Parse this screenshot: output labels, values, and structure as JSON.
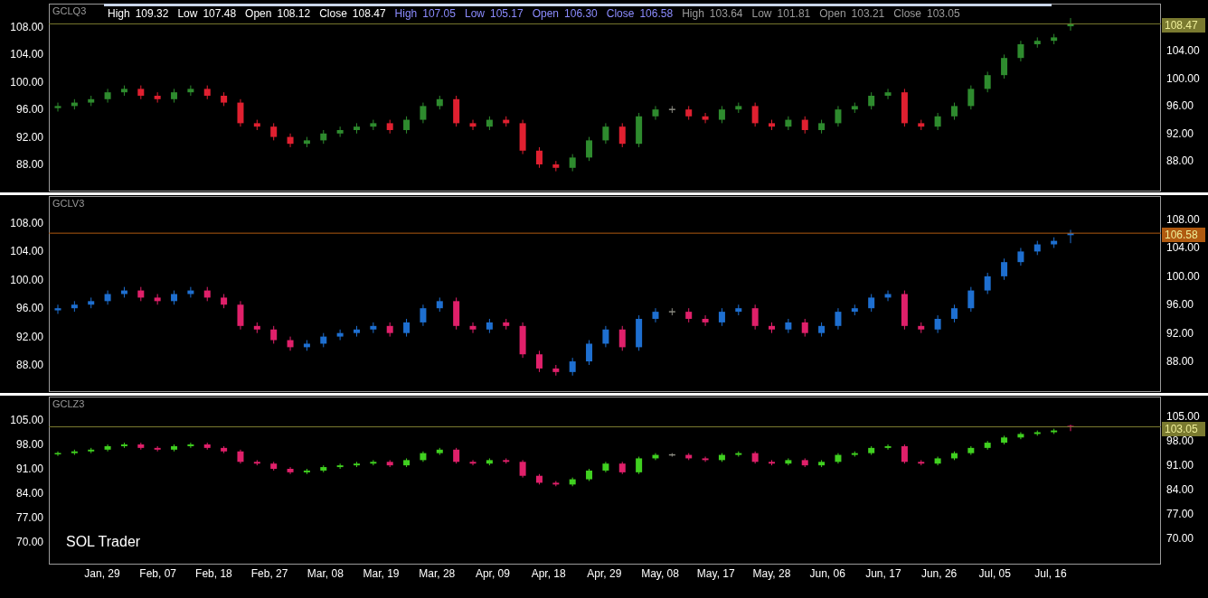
{
  "legend": [
    {
      "color": "#ffffff",
      "items": [
        {
          "label": "High",
          "value": "109.32"
        },
        {
          "label": "Low",
          "value": "107.48"
        },
        {
          "label": "Open",
          "value": "108.12"
        },
        {
          "label": "Close",
          "value": "108.47"
        }
      ]
    },
    {
      "color": "#8c8cff",
      "items": [
        {
          "label": "High",
          "value": "107.05"
        },
        {
          "label": "Low",
          "value": "105.17"
        },
        {
          "label": "Open",
          "value": "106.30"
        },
        {
          "label": "Close",
          "value": "106.58"
        }
      ]
    },
    {
      "color": "#9a9a9a",
      "items": [
        {
          "label": "High",
          "value": "103.64"
        },
        {
          "label": "Low",
          "value": "101.81"
        },
        {
          "label": "Open",
          "value": "103.21"
        },
        {
          "label": "Close",
          "value": "103.05"
        }
      ]
    }
  ],
  "panels": [
    {
      "symbol": "GCLQ3",
      "right_labels": [
        "104.00",
        "100.00",
        "96.00",
        "92.00",
        "88.00"
      ],
      "chart_data": {
        "type": "candlestick",
        "ylim": [
          84.05,
          111.42
        ],
        "yticks": [
          {
            "value": 108,
            "label": "108.00"
          },
          {
            "value": 104,
            "label": "104.00"
          },
          {
            "value": 100,
            "label": "100.00"
          },
          {
            "value": 96,
            "label": "96.00"
          },
          {
            "value": 92,
            "label": "92.00"
          },
          {
            "value": 88,
            "label": "88.00"
          }
        ],
        "ref_lines": [
          {
            "axis": "y",
            "value": 108.47,
            "label": "108.47",
            "color": "#7a7a30"
          }
        ],
        "ohlc": [
          [
            96.2,
            97,
            95.7,
            96.5
          ],
          [
            96.5,
            97.5,
            96,
            97
          ],
          [
            97,
            98,
            96.5,
            97.5
          ],
          [
            97.5,
            99,
            97,
            98.5
          ],
          [
            98.5,
            99.5,
            98,
            99
          ],
          [
            99,
            99.5,
            97.5,
            98
          ],
          [
            98,
            98.5,
            97,
            97.5
          ],
          [
            97.5,
            99,
            97,
            98.5
          ],
          [
            98.5,
            99.5,
            98,
            99
          ],
          [
            99,
            99.5,
            97.5,
            98
          ],
          [
            98,
            98.5,
            96.5,
            97
          ],
          [
            97,
            97.5,
            93.5,
            94
          ],
          [
            94,
            94.5,
            93,
            93.5
          ],
          [
            93.5,
            94,
            91.5,
            92
          ],
          [
            92,
            92.5,
            90.5,
            91
          ],
          [
            91,
            92,
            90.5,
            91.5
          ],
          [
            91.5,
            93,
            91,
            92.5
          ],
          [
            92.5,
            93.5,
            92,
            93
          ],
          [
            93,
            94,
            92.5,
            93.5
          ],
          [
            93.5,
            94.5,
            93,
            94
          ],
          [
            94,
            94.5,
            92.5,
            93
          ],
          [
            93,
            95,
            92.5,
            94.5
          ],
          [
            94.5,
            97,
            94,
            96.5
          ],
          [
            96.5,
            98,
            96,
            97.5
          ],
          [
            97.5,
            98,
            93.5,
            94
          ],
          [
            94,
            94.5,
            93,
            93.5
          ],
          [
            93.5,
            95,
            93,
            94.5
          ],
          [
            94.5,
            95,
            93.5,
            94
          ],
          [
            94,
            94.5,
            89.5,
            90
          ],
          [
            90,
            90.5,
            87.5,
            88
          ],
          [
            88,
            88.5,
            87,
            87.5
          ],
          [
            87.5,
            89.5,
            87,
            89
          ],
          [
            89,
            92,
            88.5,
            91.5
          ],
          [
            91.5,
            94,
            91,
            93.5
          ],
          [
            93.5,
            94,
            90.5,
            91
          ],
          [
            91,
            95.5,
            90.5,
            95
          ],
          [
            95,
            96.5,
            94.5,
            96
          ],
          [
            96,
            96.5,
            95.5,
            96
          ],
          [
            96,
            96.5,
            94.5,
            95
          ],
          [
            95,
            95.5,
            94,
            94.5
          ],
          [
            94.5,
            96.5,
            94,
            96
          ],
          [
            96,
            97,
            95.5,
            96.5
          ],
          [
            96.5,
            97,
            93.5,
            94
          ],
          [
            94,
            94.5,
            93,
            93.5
          ],
          [
            93.5,
            95,
            93,
            94.5
          ],
          [
            94.5,
            95,
            92.5,
            93
          ],
          [
            93,
            94.5,
            92.5,
            94
          ],
          [
            94,
            96.5,
            93.5,
            96
          ],
          [
            96,
            97,
            95.5,
            96.5
          ],
          [
            96.5,
            98.5,
            96,
            98
          ],
          [
            98,
            99,
            97.5,
            98.5
          ],
          [
            98.5,
            99,
            93.5,
            94
          ],
          [
            94,
            94.5,
            93,
            93.5
          ],
          [
            93.5,
            95.5,
            93,
            95
          ],
          [
            95,
            97,
            94.5,
            96.5
          ],
          [
            96.5,
            99.5,
            96,
            99
          ],
          [
            99,
            101.5,
            98.5,
            101
          ],
          [
            101,
            104,
            100.5,
            103.5
          ],
          [
            103.5,
            106,
            103,
            105.5
          ],
          [
            105.5,
            106.5,
            105,
            106
          ],
          [
            106,
            107,
            105.5,
            106.5
          ],
          [
            108.12,
            109.32,
            107.48,
            108.47
          ]
        ]
      }
    },
    {
      "symbol": "GCLV3",
      "right_labels": [
        "108.00",
        "104.00",
        "100.00",
        "96.00",
        "92.00",
        "88.00"
      ],
      "chart_data": {
        "type": "candlestick",
        "ylim": [
          84.18,
          111.82
        ],
        "yticks": [
          {
            "value": 108,
            "label": "108.00"
          },
          {
            "value": 104,
            "label": "104.00"
          },
          {
            "value": 100,
            "label": "100.00"
          },
          {
            "value": 96,
            "label": "96.00"
          },
          {
            "value": 92,
            "label": "92.00"
          },
          {
            "value": 88,
            "label": "88.00"
          }
        ],
        "ref_lines": [
          {
            "axis": "y",
            "value": 106.58,
            "label": "106.58",
            "color": "#b05a10"
          }
        ],
        "ohlc": [
          [
            95.7,
            96.5,
            95.2,
            96
          ],
          [
            96,
            97,
            95.5,
            96.5
          ],
          [
            96.5,
            97.5,
            96,
            97
          ],
          [
            97,
            98.5,
            96.5,
            98
          ],
          [
            98,
            99,
            97.5,
            98.5
          ],
          [
            98.5,
            99,
            97,
            97.5
          ],
          [
            97.5,
            98,
            96.5,
            97
          ],
          [
            97,
            98.5,
            96.5,
            98
          ],
          [
            98,
            99,
            97.5,
            98.5
          ],
          [
            98.5,
            99,
            97,
            97.5
          ],
          [
            97.5,
            98,
            96,
            96.5
          ],
          [
            96.5,
            97,
            93,
            93.5
          ],
          [
            93.5,
            94,
            92.5,
            93
          ],
          [
            93,
            93.5,
            91,
            91.5
          ],
          [
            91.5,
            92,
            90,
            90.5
          ],
          [
            90.5,
            91.5,
            90,
            91
          ],
          [
            91,
            92.5,
            90.5,
            92
          ],
          [
            92,
            93,
            91.5,
            92.5
          ],
          [
            92.5,
            93.5,
            92,
            93
          ],
          [
            93,
            94,
            92.5,
            93.5
          ],
          [
            93.5,
            94,
            92,
            92.5
          ],
          [
            92.5,
            94.5,
            92,
            94
          ],
          [
            94,
            96.5,
            93.5,
            96
          ],
          [
            96,
            97.5,
            95.5,
            97
          ],
          [
            97,
            97.5,
            93,
            93.5
          ],
          [
            93.5,
            94,
            92.5,
            93
          ],
          [
            93,
            94.5,
            92.5,
            94
          ],
          [
            94,
            94.5,
            93,
            93.5
          ],
          [
            93.5,
            94,
            89,
            89.5
          ],
          [
            89.5,
            90,
            87,
            87.5
          ],
          [
            87.5,
            88,
            86.5,
            87
          ],
          [
            87,
            89,
            86.5,
            88.5
          ],
          [
            88.5,
            91.5,
            88,
            91
          ],
          [
            91,
            93.5,
            90.5,
            93
          ],
          [
            93,
            93.5,
            90,
            90.5
          ],
          [
            90.5,
            95,
            90,
            94.5
          ],
          [
            94.5,
            96,
            94,
            95.5
          ],
          [
            95.5,
            96,
            95,
            95.5
          ],
          [
            95.5,
            96,
            94,
            94.5
          ],
          [
            94.5,
            95,
            93.5,
            94
          ],
          [
            94,
            96,
            93.5,
            95.5
          ],
          [
            95.5,
            96.5,
            95,
            96
          ],
          [
            96,
            96.5,
            93,
            93.5
          ],
          [
            93.5,
            94,
            92.5,
            93
          ],
          [
            93,
            94.5,
            92.5,
            94
          ],
          [
            94,
            94.5,
            92,
            92.5
          ],
          [
            92.5,
            94,
            92,
            93.5
          ],
          [
            93.5,
            96,
            93,
            95.5
          ],
          [
            95.5,
            96.5,
            95,
            96
          ],
          [
            96,
            98,
            95.5,
            97.5
          ],
          [
            97.5,
            98.5,
            97,
            98
          ],
          [
            98,
            98.5,
            93,
            93.5
          ],
          [
            93.5,
            94,
            92.5,
            93
          ],
          [
            93,
            95,
            92.5,
            94.5
          ],
          [
            94.5,
            96.5,
            94,
            96
          ],
          [
            96,
            99,
            95.5,
            98.5
          ],
          [
            98.5,
            101,
            98,
            100.5
          ],
          [
            100.5,
            103,
            100,
            102.5
          ],
          [
            102.5,
            104.5,
            102,
            104
          ],
          [
            104,
            105.5,
            103.5,
            105
          ],
          [
            105,
            106,
            104.5,
            105.5
          ],
          [
            106.3,
            107.05,
            105.17,
            106.58
          ]
        ]
      }
    },
    {
      "symbol": "GCLZ3",
      "right_labels": [
        "105.00",
        "98.00",
        "91.00",
        "84.00",
        "77.00",
        "70.00"
      ],
      "chart_data": {
        "type": "candlestick",
        "ylim": [
          63.52,
          111.74
        ],
        "yticks": [
          {
            "value": 105,
            "label": "105.00"
          },
          {
            "value": 98,
            "label": "98.00"
          },
          {
            "value": 91,
            "label": "91.00"
          },
          {
            "value": 84,
            "label": "84.00"
          },
          {
            "value": 77,
            "label": "77.00"
          },
          {
            "value": 70,
            "label": "70.00"
          }
        ],
        "ref_lines": [
          {
            "axis": "y",
            "value": 103.05,
            "label": "103.05",
            "color": "#7a7a30"
          }
        ],
        "ohlc": [
          [
            95.2,
            96,
            94.7,
            95.5
          ],
          [
            95.5,
            96.5,
            95,
            96
          ],
          [
            96,
            97,
            95.5,
            96.5
          ],
          [
            96.5,
            98,
            96,
            97.5
          ],
          [
            97.5,
            98.5,
            97,
            98
          ],
          [
            98,
            98.5,
            96.5,
            97
          ],
          [
            97,
            97.5,
            96,
            96.5
          ],
          [
            96.5,
            98,
            96,
            97.5
          ],
          [
            97.5,
            98.5,
            97,
            98
          ],
          [
            98,
            98.5,
            96.5,
            97
          ],
          [
            97,
            97.5,
            95.5,
            96
          ],
          [
            96,
            96.5,
            92.5,
            93
          ],
          [
            93,
            93.5,
            92,
            92.5
          ],
          [
            92.5,
            93,
            90.5,
            91
          ],
          [
            91,
            91.5,
            89.5,
            90
          ],
          [
            90,
            91,
            89.5,
            90.5
          ],
          [
            90.5,
            92,
            90,
            91.5
          ],
          [
            91.5,
            92.5,
            91,
            92
          ],
          [
            92,
            93,
            91.5,
            92.5
          ],
          [
            92.5,
            93.5,
            92,
            93
          ],
          [
            93,
            93.5,
            91.5,
            92
          ],
          [
            92,
            94,
            91.5,
            93.5
          ],
          [
            93.5,
            96,
            93,
            95.5
          ],
          [
            95.5,
            97,
            95,
            96.5
          ],
          [
            96.5,
            97,
            92.5,
            93
          ],
          [
            93,
            93.5,
            92,
            92.5
          ],
          [
            92.5,
            94,
            92,
            93.5
          ],
          [
            93.5,
            94,
            92.5,
            93
          ],
          [
            93,
            93.5,
            88.5,
            89
          ],
          [
            89,
            89.5,
            86.5,
            87
          ],
          [
            87,
            87.5,
            86,
            86.5
          ],
          [
            86.5,
            88.5,
            86,
            88
          ],
          [
            88,
            91,
            87.5,
            90.5
          ],
          [
            90.5,
            93,
            90,
            92.5
          ],
          [
            92.5,
            93,
            89.5,
            90
          ],
          [
            90,
            94.5,
            89.5,
            94
          ],
          [
            94,
            95.5,
            93.5,
            95
          ],
          [
            95,
            95.5,
            94.5,
            95
          ],
          [
            95,
            95.5,
            93.5,
            94
          ],
          [
            94,
            94.5,
            93,
            93.5
          ],
          [
            93.5,
            95.5,
            93,
            95
          ],
          [
            95,
            96,
            94.5,
            95.5
          ],
          [
            95.5,
            96,
            92.5,
            93
          ],
          [
            93,
            93.5,
            92,
            92.5
          ],
          [
            92.5,
            94,
            92,
            93.5
          ],
          [
            93.5,
            94,
            91.5,
            92
          ],
          [
            92,
            93.5,
            91.5,
            93
          ],
          [
            93,
            95.5,
            92.5,
            95
          ],
          [
            95,
            96,
            94.5,
            95.5
          ],
          [
            95.5,
            97.5,
            95,
            97
          ],
          [
            97,
            98,
            96.5,
            97.5
          ],
          [
            97.5,
            98,
            92.5,
            93
          ],
          [
            93,
            93.5,
            92,
            92.5
          ],
          [
            92.5,
            94.5,
            92,
            94
          ],
          [
            94,
            96,
            93.5,
            95.5
          ],
          [
            95.5,
            97.5,
            95,
            97
          ],
          [
            97,
            99,
            96.5,
            98.5
          ],
          [
            98.5,
            100.5,
            98,
            100
          ],
          [
            100,
            101.5,
            99.5,
            101
          ],
          [
            101,
            102,
            100.5,
            101.5
          ],
          [
            101.5,
            102.5,
            101,
            102
          ],
          [
            103.21,
            103.64,
            101.81,
            103.05
          ]
        ]
      }
    }
  ],
  "watermark_label": "SOL Trader",
  "x_axis_labels": [
    "Jan, 29",
    "Feb, 07",
    "Feb, 18",
    "Feb, 27",
    "Mar, 08",
    "Mar, 19",
    "Mar, 28",
    "Apr, 09",
    "Apr, 18",
    "Apr, 29",
    "May, 08",
    "May, 17",
    "May, 28",
    "Jun, 06",
    "Jun, 17",
    "Jun, 26",
    "Jul, 05",
    "Jul, 16"
  ]
}
